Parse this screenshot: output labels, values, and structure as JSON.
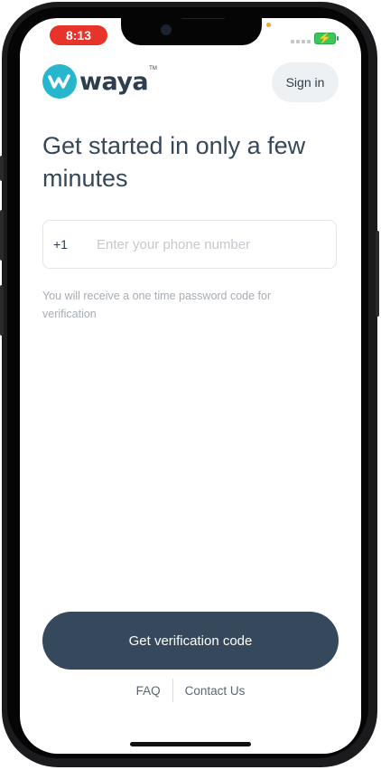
{
  "status_bar": {
    "time": "8:13"
  },
  "header": {
    "logo_text": "waya",
    "logo_tm": "TM",
    "sign_in_label": "Sign in"
  },
  "main": {
    "headline": "Get started in only a few minutes",
    "phone": {
      "country_code": "+1",
      "placeholder": "Enter your phone number",
      "value": ""
    },
    "helper_text": "You will receive a one time password code for verification",
    "cta_label": "Get verification code"
  },
  "footer": {
    "faq_label": "FAQ",
    "contact_label": "Contact Us"
  },
  "colors": {
    "brand_teal": "#27b7cc",
    "primary_dark": "#36485b",
    "status_time_bg": "#e8332b",
    "battery_green": "#3cc65a"
  },
  "icons": [
    "waya-logo-icon",
    "signal-icon",
    "battery-icon",
    "camera-icon"
  ]
}
